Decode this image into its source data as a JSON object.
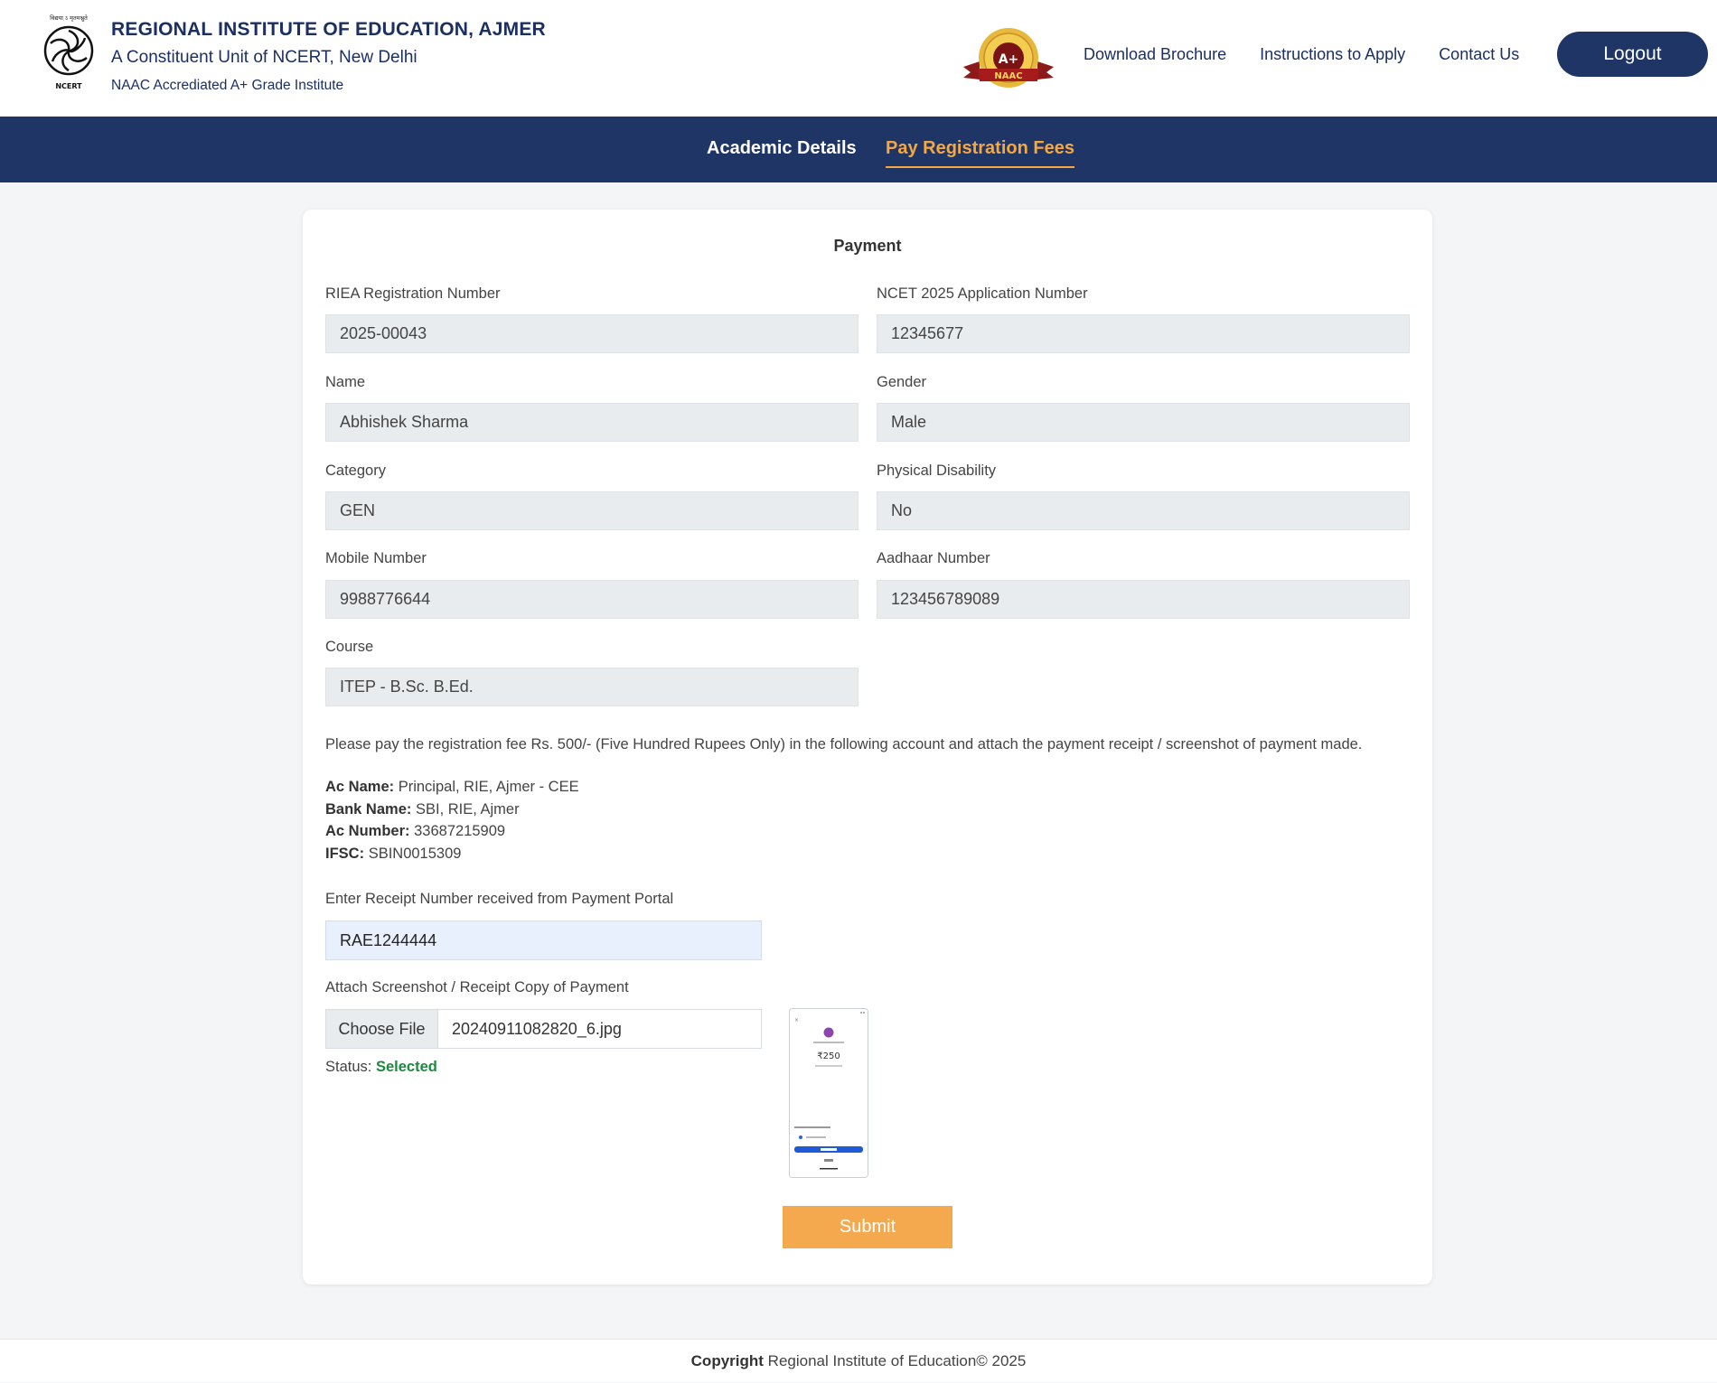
{
  "header": {
    "emblem_top_text": "विद्यया ऽ मृतमश्नुते",
    "emblem_bottom_text": "NCERT",
    "institute_name": "REGIONAL INSTITUTE OF EDUCATION, AJMER",
    "subtitle": "A Constituent Unit of NCERT, New Delhi",
    "accreditation": "NAAC Accrediated A+ Grade Institute",
    "badge": {
      "grade": "A+",
      "ribbon": "NAAC"
    },
    "nav": [
      "Download Brochure",
      "Instructions to Apply",
      "Contact Us"
    ],
    "logout_label": "Logout"
  },
  "tabs": [
    {
      "label": "Academic Details",
      "active": false
    },
    {
      "label": "Pay Registration Fees",
      "active": true
    }
  ],
  "form": {
    "title": "Payment",
    "fields": {
      "riea_label": "RIEA Registration Number",
      "riea_value": "2025-00043",
      "ncet_label": "NCET 2025 Application Number",
      "ncet_value": "12345677",
      "name_label": "Name",
      "name_value": "Abhishek Sharma",
      "gender_label": "Gender",
      "gender_value": "Male",
      "category_label": "Category",
      "category_value": "GEN",
      "disability_label": "Physical Disability",
      "disability_value": "No",
      "mobile_label": "Mobile Number",
      "mobile_value": "9988776644",
      "aadhaar_label": "Aadhaar Number",
      "aadhaar_value": "123456789089",
      "course_label": "Course",
      "course_value": "ITEP - B.Sc. B.Ed."
    },
    "notice": "Please pay the registration fee Rs. 500/- (Five Hundred Rupees Only) in the following account and attach the payment receipt / screenshot of payment made.",
    "account": {
      "ac_name_label": "Ac Name:",
      "ac_name_value": "Principal, RIE, Ajmer - CEE",
      "bank_label": "Bank Name:",
      "bank_value": "SBI, RIE, Ajmer",
      "ac_number_label": "Ac Number:",
      "ac_number_value": "33687215909",
      "ifsc_label": "IFSC:",
      "ifsc_value": "SBIN0015309"
    },
    "receipt_label": "Enter Receipt Number received from Payment Portal",
    "receipt_value": "RAE1244444",
    "attach_label": "Attach Screenshot / Receipt Copy of Payment",
    "choose_file_label": "Choose File",
    "file_name": "20240911082820_6.jpg",
    "status_label": "Status:",
    "status_value": "Selected",
    "preview_amount": "₹250",
    "submit_label": "Submit"
  },
  "footer": {
    "copyright_bold": "Copyright",
    "copyright_text": "Regional Institute of Education© 2025"
  },
  "colors": {
    "navy": "#1e3566",
    "accent_orange": "#f5a742",
    "status_green": "#1a8a3e"
  }
}
